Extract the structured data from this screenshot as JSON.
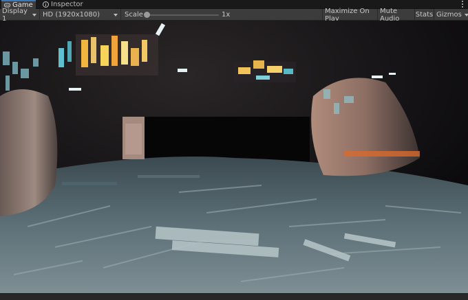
{
  "tabs": [
    {
      "label": "Game",
      "icon": "gamepad-icon",
      "active": true
    },
    {
      "label": "Inspector",
      "icon": "info-icon",
      "active": false
    }
  ],
  "toolbar": {
    "display": "Display 1",
    "resolution": "HD (1920x1080)",
    "scale_label": "Scale",
    "scale_value": "1x",
    "maximize_on_play": "Maximize On Play",
    "mute_audio": "Mute Audio",
    "stats": "Stats",
    "gizmos": "Gizmos"
  },
  "colors": {
    "accent": "#3a79bb",
    "panel": "#3c3c3c",
    "background": "#191919"
  }
}
